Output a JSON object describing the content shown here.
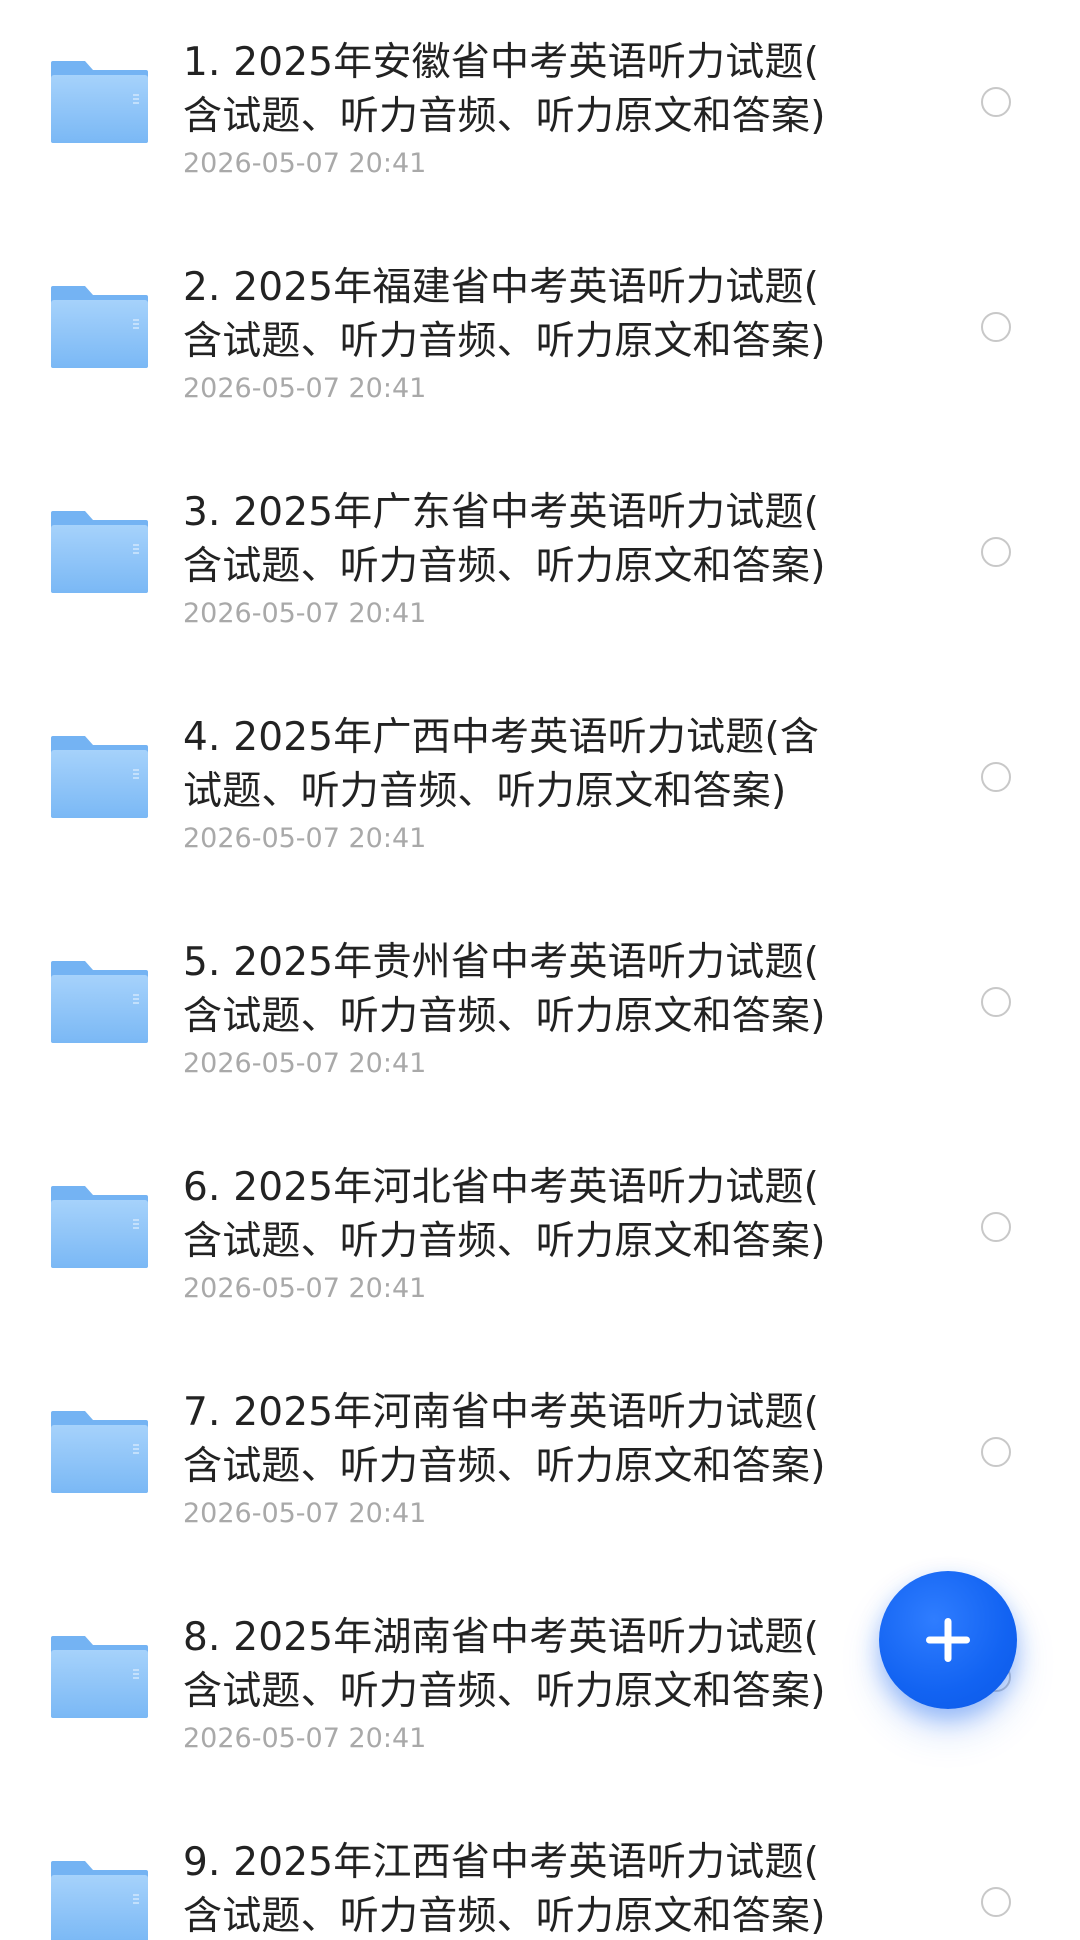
{
  "files": [
    {
      "title": "1. 2025年安徽省中考英语听力试题(含试题、听力音频、听力原文和答案)",
      "line1": "1. 2025年安徽省中考英语听力试题(",
      "line2": "含试题、听力音频、听力原文和答案)",
      "date": "2026-05-07 20:41"
    },
    {
      "title": "2. 2025年福建省中考英语听力试题(含试题、听力音频、听力原文和答案)",
      "line1": "2. 2025年福建省中考英语听力试题(",
      "line2": "含试题、听力音频、听力原文和答案)",
      "date": "2026-05-07 20:41"
    },
    {
      "title": "3. 2025年广东省中考英语听力试题(含试题、听力音频、听力原文和答案)",
      "line1": "3. 2025年广东省中考英语听力试题(",
      "line2": "含试题、听力音频、听力原文和答案)",
      "date": "2026-05-07 20:41"
    },
    {
      "title": "4. 2025年广西中考英语听力试题(含试题、听力音频、听力原文和答案)",
      "line1": "4. 2025年广西中考英语听力试题(含",
      "line2": "试题、听力音频、听力原文和答案)",
      "date": "2026-05-07 20:41"
    },
    {
      "title": "5. 2025年贵州省中考英语听力试题(含试题、听力音频、听力原文和答案)",
      "line1": "5. 2025年贵州省中考英语听力试题(",
      "line2": "含试题、听力音频、听力原文和答案)",
      "date": "2026-05-07 20:41"
    },
    {
      "title": "6. 2025年河北省中考英语听力试题(含试题、听力音频、听力原文和答案)",
      "line1": "6. 2025年河北省中考英语听力试题(",
      "line2": "含试题、听力音频、听力原文和答案)",
      "date": "2026-05-07 20:41"
    },
    {
      "title": "7. 2025年河南省中考英语听力试题(含试题、听力音频、听力原文和答案)",
      "line1": "7. 2025年河南省中考英语听力试题(",
      "line2": "含试题、听力音频、听力原文和答案)",
      "date": "2026-05-07 20:41"
    },
    {
      "title": "8. 2025年湖南省中考英语听力试题(含试题、听力音频、听力原文和答案)",
      "line1": "8. 2025年湖南省中考英语听力试题(",
      "line2": "含试题、听力音频、听力原文和答案)",
      "date": "2026-05-07 20:41"
    },
    {
      "title": "9. 2025年江西省中考英语听力试题(含试题、听力音频、听力原文和答案)",
      "line1": "9. 2025年江西省中考英语听力试题(",
      "line2": "含试题、听力音频、听力原文和答案)",
      "date": ""
    }
  ],
  "icons": {
    "file_icon": "folder-icon",
    "select": "radio-unchecked-icon",
    "fab": "plus-icon"
  },
  "colors": {
    "folder_light": "#a9d3fb",
    "folder_dark": "#6fb1f4",
    "fab": "#1766f5",
    "title": "#222222",
    "date": "#a9a9a9",
    "radio": "#c8c8c8"
  }
}
